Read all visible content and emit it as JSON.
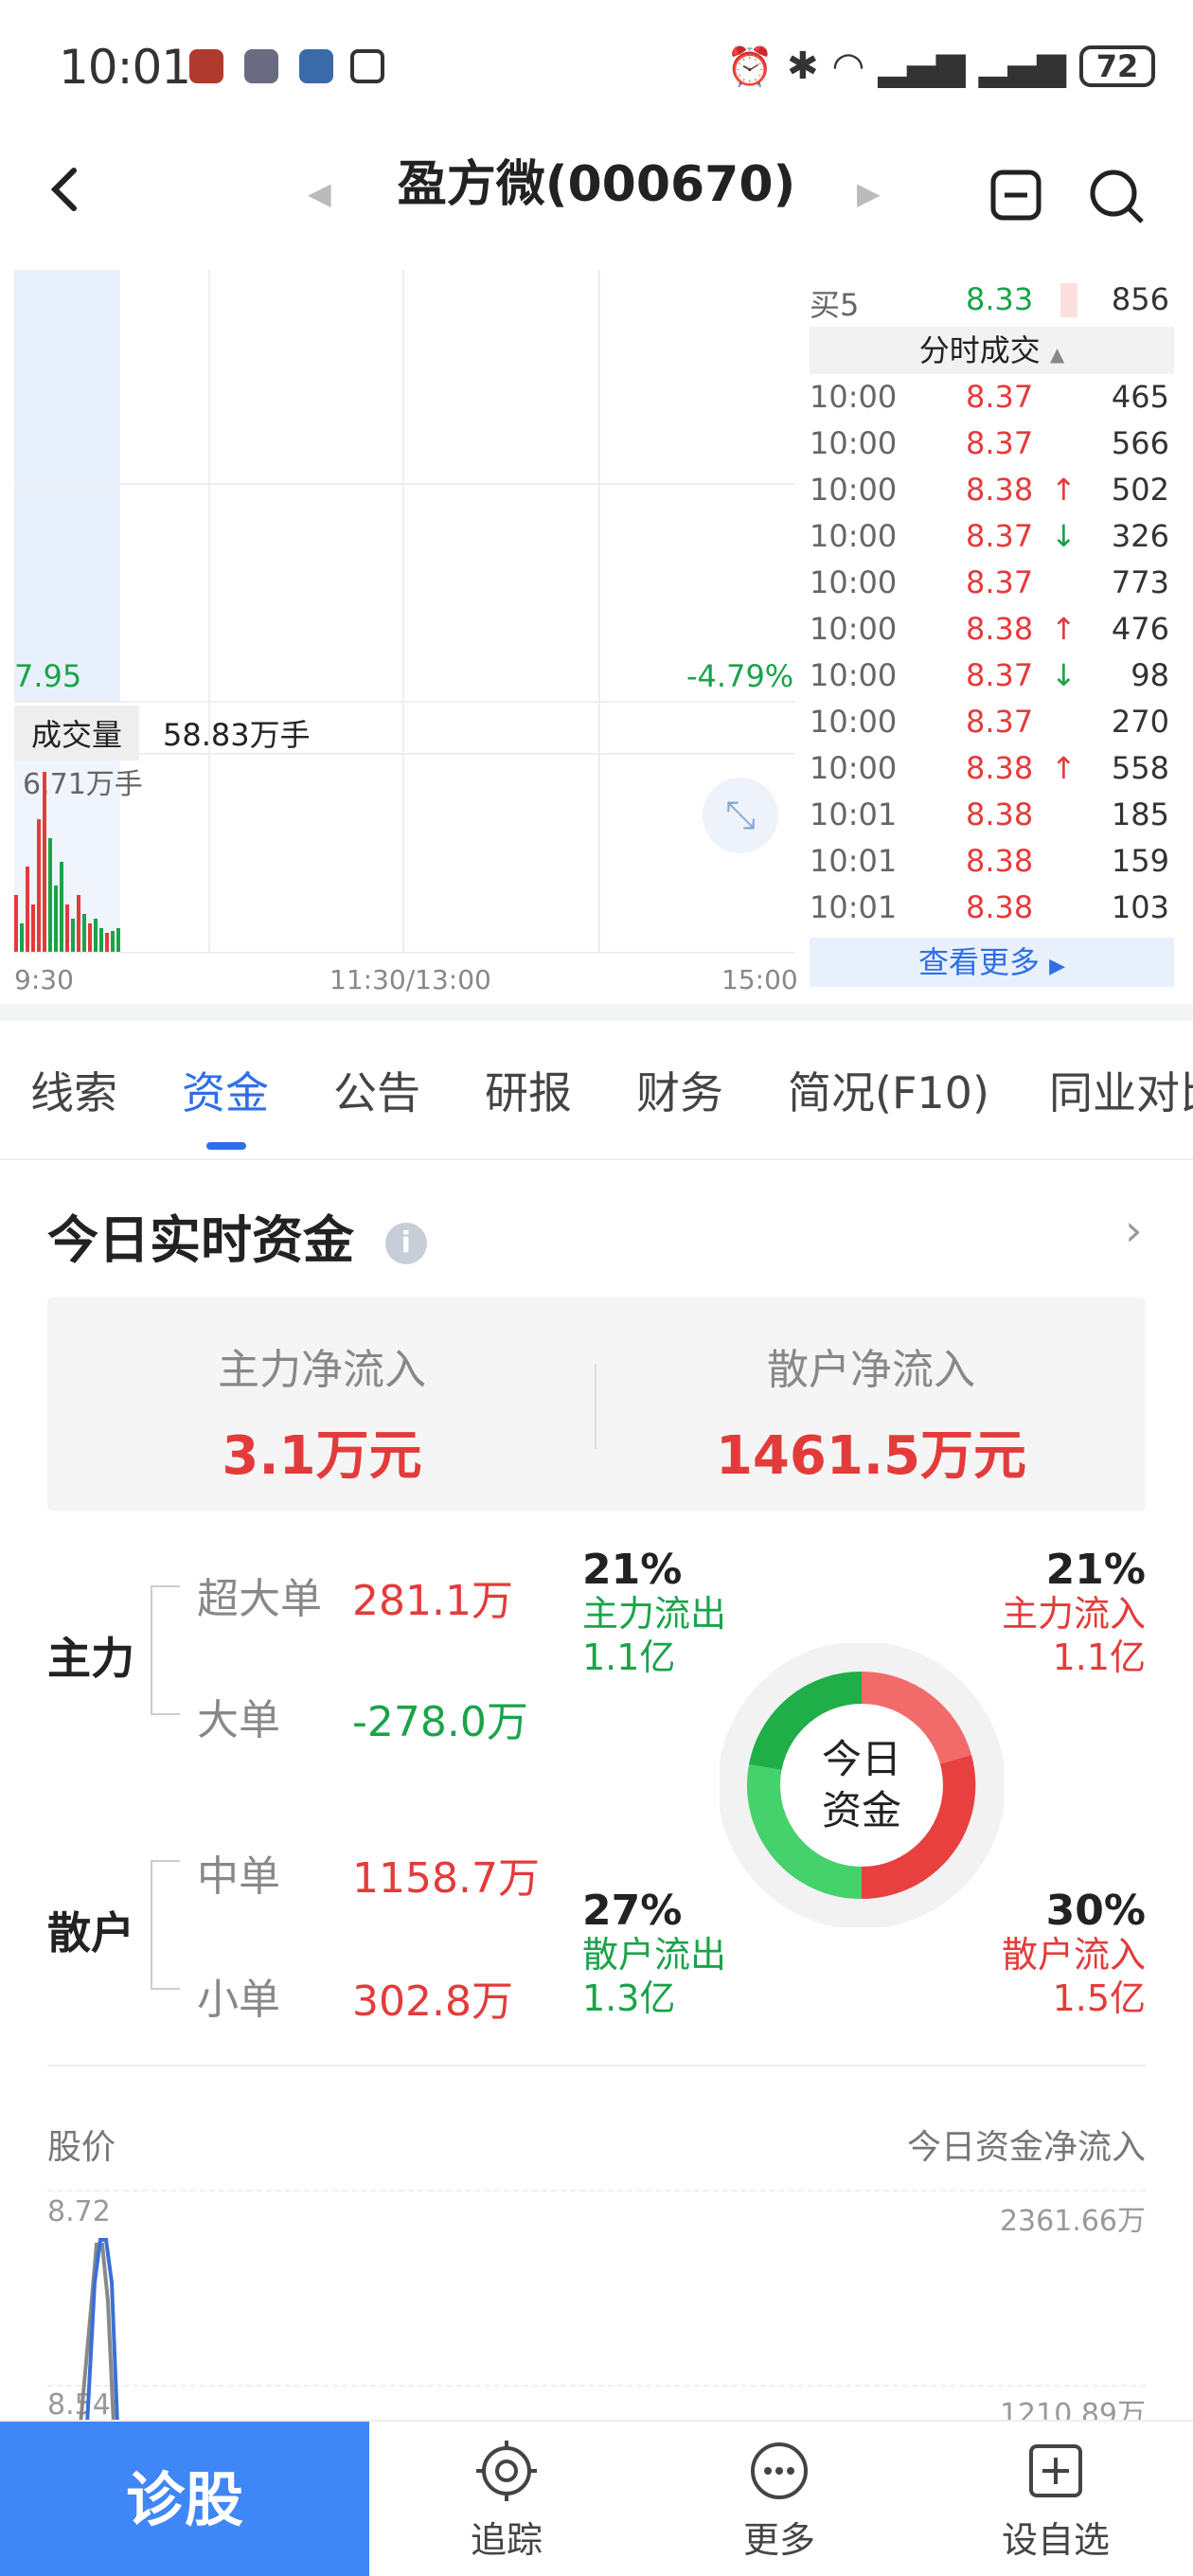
{
  "status_bar": {
    "time": "10:01",
    "battery": "72"
  },
  "header": {
    "title": "盈方微(000670)"
  },
  "chart": {
    "price_low": "7.95",
    "change_pct": "-4.79%",
    "volume_label": "成交量",
    "volume_value": "58.83万手",
    "volume_max": "6.71万手",
    "x_labels": [
      "9:30",
      "11:30/13:00",
      "15:00"
    ]
  },
  "order_book": {
    "label": "买5",
    "price": "8.33",
    "volume": "856"
  },
  "trades": {
    "header": "分时成交",
    "more_label": "查看更多",
    "rows": [
      {
        "time": "10:00",
        "price": "8.37",
        "dir": "",
        "vol": "465"
      },
      {
        "time": "10:00",
        "price": "8.37",
        "dir": "",
        "vol": "566"
      },
      {
        "time": "10:00",
        "price": "8.38",
        "dir": "↑",
        "vol": "502"
      },
      {
        "time": "10:00",
        "price": "8.37",
        "dir": "↓",
        "vol": "326"
      },
      {
        "time": "10:00",
        "price": "8.37",
        "dir": "",
        "vol": "773"
      },
      {
        "time": "10:00",
        "price": "8.38",
        "dir": "↑",
        "vol": "476"
      },
      {
        "time": "10:00",
        "price": "8.37",
        "dir": "↓",
        "vol": "98"
      },
      {
        "time": "10:00",
        "price": "8.37",
        "dir": "",
        "vol": "270"
      },
      {
        "time": "10:00",
        "price": "8.38",
        "dir": "↑",
        "vol": "558"
      },
      {
        "time": "10:01",
        "price": "8.38",
        "dir": "",
        "vol": "185"
      },
      {
        "time": "10:01",
        "price": "8.38",
        "dir": "",
        "vol": "159"
      },
      {
        "time": "10:01",
        "price": "8.38",
        "dir": "",
        "vol": "103"
      }
    ]
  },
  "tabs": [
    "线索",
    "资金",
    "公告",
    "研报",
    "财务",
    "简况(F10)",
    "同业对比"
  ],
  "funds": {
    "title": "今日实时资金",
    "main_net_label": "主力净流入",
    "main_net_value": "3.1万元",
    "retail_net_label": "散户净流入",
    "retail_net_value": "1461.5万元",
    "main_label": "主力",
    "retail_label": "散户",
    "super_label": "超大单",
    "super_value": "281.1万",
    "big_label": "大单",
    "big_value": "-278.0万",
    "mid_label": "中单",
    "mid_value": "1158.7万",
    "small_label": "小单",
    "small_value": "302.8万",
    "donut_center": [
      "今日",
      "资金"
    ],
    "quad": {
      "main_out": {
        "pct": "21%",
        "label": "主力流出",
        "amt": "1.1亿"
      },
      "main_in": {
        "pct": "21%",
        "label": "主力流入",
        "amt": "1.1亿"
      },
      "retail_out": {
        "pct": "27%",
        "label": "散户流出",
        "amt": "1.3亿"
      },
      "retail_in": {
        "pct": "30%",
        "label": "散户流入",
        "amt": "1.5亿"
      }
    }
  },
  "flow_chart": {
    "left_title": "股价",
    "right_title": "今日资金净流入",
    "y_left": [
      "8.72",
      "8.54"
    ],
    "y_right": [
      "2361.66万",
      "1210.89万"
    ]
  },
  "bottom_nav": {
    "diagnose": "诊股",
    "track": "追踪",
    "more": "更多",
    "watch": "设自选"
  },
  "colors": {
    "up": "#e33b3b",
    "down": "#1aa34a",
    "accent": "#2f6fe6",
    "primary_button": "#3f86f6"
  }
}
